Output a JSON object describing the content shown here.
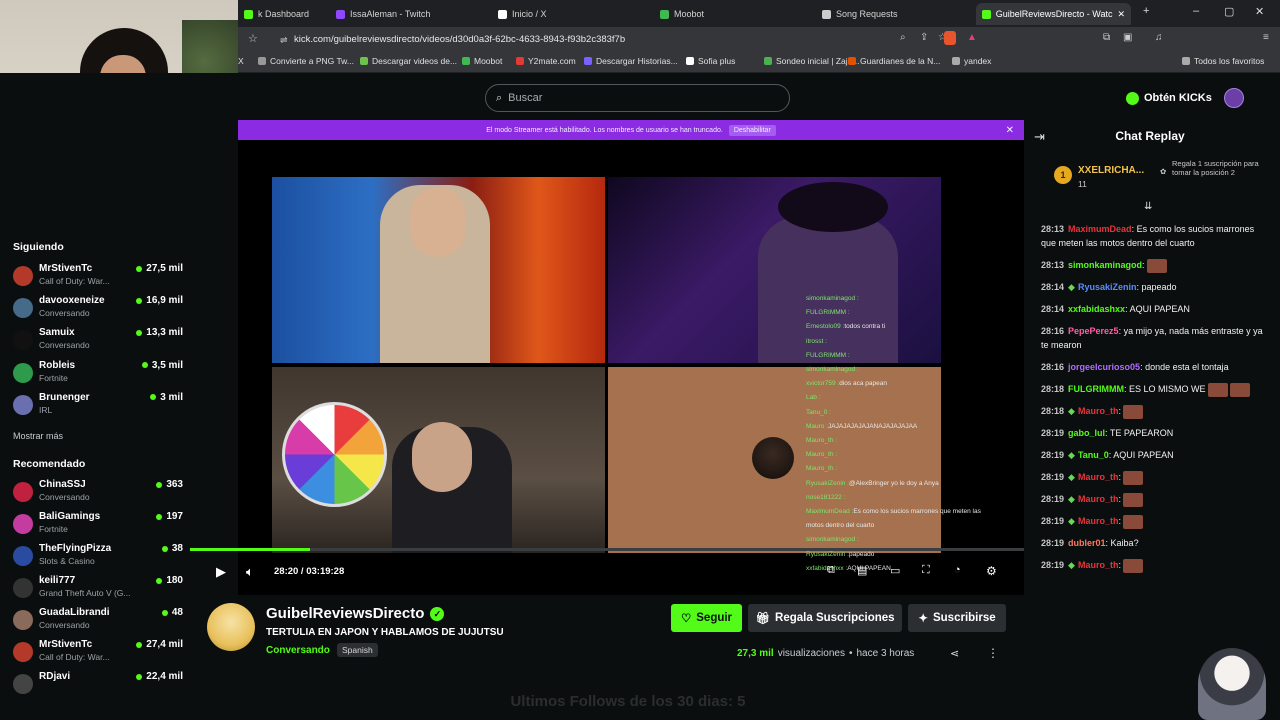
{
  "browser": {
    "tabs": [
      {
        "label": "k Dashboard",
        "color": "#53fc18"
      },
      {
        "label": "IssaAleman - Twitch",
        "color": "#9146ff"
      },
      {
        "label": "Inicio / X",
        "color": "#ffffff"
      },
      {
        "label": "Moobot",
        "color": "#3fb950"
      },
      {
        "label": "Song Requests",
        "color": "#cccccc"
      },
      {
        "label": "GuibelReviewsDirecto - Watc",
        "color": "#53fc18"
      }
    ],
    "url": "kick.com/guibelreviewsdirecto/videos/d30d0a3f-62bc-4633-8943-f93b2c383f7b",
    "bookmarks": [
      {
        "label": "X",
        "color": "#ffffff"
      },
      {
        "label": "Convierte a PNG Tw...",
        "color": "#999999"
      },
      {
        "label": "Descargar videos de...",
        "color": "#6cc24a"
      },
      {
        "label": "Moobot",
        "color": "#3fb950"
      },
      {
        "label": "Y2mate.com",
        "color": "#e53935"
      },
      {
        "label": "Descargar Historias...",
        "color": "#7b61ff"
      },
      {
        "label": "Sofia plus",
        "color": "#ffffff"
      },
      {
        "label": "Sondeo inicial | Zaju...",
        "color": "#4caf50"
      },
      {
        "label": "Guardianes de la N...",
        "color": "#e65100"
      },
      {
        "label": "yandex",
        "color": "#aaaaaa"
      },
      {
        "label": "Todos los favoritos",
        "color": "#aaaaaa"
      }
    ]
  },
  "header": {
    "search_placeholder": "Buscar",
    "kicks_label": "Obtén KICKs"
  },
  "banner": {
    "text": "El modo Streamer está habilitado. Los nombres de usuario se han truncado.",
    "button": "Deshabilitar"
  },
  "sidebar": {
    "following_title": "Siguiendo",
    "following": [
      {
        "name": "MrStivenTc",
        "category": "Call of Duty: War...",
        "viewers": "27,5 mil",
        "color": "#b33a2a"
      },
      {
        "name": "davooxeneize",
        "category": "Conversando",
        "viewers": "16,9 mil",
        "color": "#456a8a"
      },
      {
        "name": "Samuix",
        "category": "Conversando",
        "viewers": "13,3 mil",
        "color": "#111111"
      },
      {
        "name": "Robleis",
        "category": "Fortnite",
        "viewers": "3,5 mil",
        "color": "#2e9a4c"
      },
      {
        "name": "Brunenger",
        "category": "IRL",
        "viewers": "3 mil",
        "color": "#6a6fb0"
      }
    ],
    "show_more": "Mostrar más",
    "recommended_title": "Recomendado",
    "recommended": [
      {
        "name": "ChinaSSJ",
        "category": "Conversando",
        "viewers": "363",
        "color": "#c0213f"
      },
      {
        "name": "BaliGamings",
        "category": "Fortnite",
        "viewers": "197",
        "color": "#c43ca0"
      },
      {
        "name": "TheFlyingPizza",
        "category": "Slots & Casino",
        "viewers": "38",
        "color": "#2a4ca0"
      },
      {
        "name": "keili777",
        "category": "Grand Theft Auto V (G...",
        "viewers": "180",
        "color": "#333333"
      },
      {
        "name": "GuadaLibrandi",
        "category": "Conversando",
        "viewers": "48",
        "color": "#8a6a5a"
      },
      {
        "name": "MrStivenTc",
        "category": "Call of Duty: War...",
        "viewers": "27,4 mil",
        "color": "#b33a2a"
      },
      {
        "name": "RDjavi",
        "category": "",
        "viewers": "22,4 mil",
        "color": "#444444"
      }
    ]
  },
  "video_overlay_chat": [
    {
      "user": "simonkaminagod :",
      "text": ""
    },
    {
      "user": "FULGRIMMM :",
      "text": ""
    },
    {
      "user": "Ernestolo09 :",
      "text": "todos contra ti"
    },
    {
      "user": "itrosst :",
      "text": ""
    },
    {
      "user": "FULGRIMMM :",
      "text": ""
    },
    {
      "user": "simonkaminagod :",
      "text": ""
    },
    {
      "user": "xvictor759 :",
      "text": "dios aca papean"
    },
    {
      "user": "Lab :",
      "text": ""
    },
    {
      "user": "Tanu_0 :",
      "text": ""
    },
    {
      "user": "Mauro :",
      "text": "JAJAJAJAJAJANAJAJAJAJAA"
    },
    {
      "user": "Mauro_th :",
      "text": ""
    },
    {
      "user": "Mauro_th :",
      "text": ""
    },
    {
      "user": "Mauro_th :",
      "text": ""
    },
    {
      "user": "RyusakiZenin :",
      "text": "@AlexBringer yo le doy a Anya"
    },
    {
      "user": "nose181222 :",
      "text": ""
    },
    {
      "user": "MaximumDead :",
      "text": "Es como los sucios marrones que meten las"
    },
    {
      "user": "",
      "text": "motos dentro del cuarto"
    },
    {
      "user": "simonkaminagod :",
      "text": ""
    },
    {
      "user": "RyusakiZenin :",
      "text": "papeado"
    },
    {
      "user": "xxfabidashxx :",
      "text": "AQUI PAPEAN"
    }
  ],
  "player": {
    "time": "28:20 / 03:19:28",
    "progress": 0.144
  },
  "stream": {
    "channel": "GuibelReviewsDirecto",
    "title": "TERTULIA EN JAPON Y HABLAMOS DE JUJUTSU",
    "category": "Conversando",
    "language": "Spanish",
    "follow": "Seguir",
    "gift": "Regala Suscripciones",
    "subscribe": "Suscribirse",
    "views_num": "27,3 mil",
    "views_label": "visualizaciones",
    "sep": "•",
    "ago": "hace 3 horas"
  },
  "overlay_text": "Ultimos Follows de los 30 dias: 5",
  "chat": {
    "title": "Chat Replay",
    "leader": {
      "rank": "1",
      "name": "XXELRICHA...",
      "count": "11",
      "gift_text": "Regala 1 suscripción para tomar la posición 2"
    },
    "messages": [
      {
        "ts": "28:13",
        "user": "MaximumDead",
        "color": "#e8343a",
        "text": ": Es como los sucios marrones que meten las motos dentro del cuarto",
        "emotes": 0,
        "badge": false,
        "lines": 2
      },
      {
        "ts": "28:13",
        "user": "simonkaminagod",
        "color": "#53fc18",
        "text": ":",
        "emotes": 1,
        "badge": false,
        "lines": 1
      },
      {
        "ts": "28:14",
        "user": "RyusakiZenin",
        "color": "#5b8cff",
        "text": ": papeado",
        "emotes": 0,
        "badge": true,
        "lines": 1
      },
      {
        "ts": "28:14",
        "user": "xxfabidashxx",
        "color": "#53fc18",
        "text": ": AQUI PAPEAN",
        "emotes": 0,
        "badge": false,
        "lines": 1
      },
      {
        "ts": "28:16",
        "user": "PepePerez5",
        "color": "#ff5fa8",
        "text": ": ya mijo ya, nada más entraste y ya te mearon",
        "emotes": 0,
        "badge": false,
        "lines": 2
      },
      {
        "ts": "28:16",
        "user": "jorgeelcurioso05",
        "color": "#b36bff",
        "text": ": donde esta el tontaja",
        "emotes": 0,
        "badge": false,
        "lines": 1
      },
      {
        "ts": "28:18",
        "user": "FULGRIMMM",
        "color": "#53fc18",
        "text": ": ES LO MISMO WE",
        "emotes": 2,
        "badge": false,
        "lines": 1
      },
      {
        "ts": "28:18",
        "user": "Mauro_th",
        "color": "#e8343a",
        "text": ":",
        "emotes": 1,
        "badge": true,
        "lines": 1
      },
      {
        "ts": "28:19",
        "user": "gabo_lul",
        "color": "#53fc18",
        "text": ": TE PAPEARON",
        "emotes": 0,
        "badge": false,
        "lines": 1
      },
      {
        "ts": "28:19",
        "user": "Tanu_0",
        "color": "#53fc18",
        "text": ": AQUI PAPEAN",
        "emotes": 0,
        "badge": true,
        "lines": 1
      },
      {
        "ts": "28:19",
        "user": "Mauro_th",
        "color": "#e8343a",
        "text": ":",
        "emotes": 1,
        "badge": true,
        "lines": 1
      },
      {
        "ts": "28:19",
        "user": "Mauro_th",
        "color": "#e8343a",
        "text": ":",
        "emotes": 1,
        "badge": true,
        "lines": 1
      },
      {
        "ts": "28:19",
        "user": "Mauro_th",
        "color": "#e8343a",
        "text": ":",
        "emotes": 1,
        "badge": true,
        "lines": 1
      },
      {
        "ts": "28:19",
        "user": "dubler01",
        "color": "#ff7a5c",
        "text": ": Kaiba?",
        "emotes": 0,
        "badge": false,
        "lines": 1
      },
      {
        "ts": "28:19",
        "user": "Mauro_th",
        "color": "#e8343a",
        "text": ":",
        "emotes": 1,
        "badge": true,
        "lines": 1
      }
    ]
  },
  "colors": {
    "accent": "#53fc18",
    "banner": "#8b2be2",
    "bg": "#0b0e0f"
  }
}
